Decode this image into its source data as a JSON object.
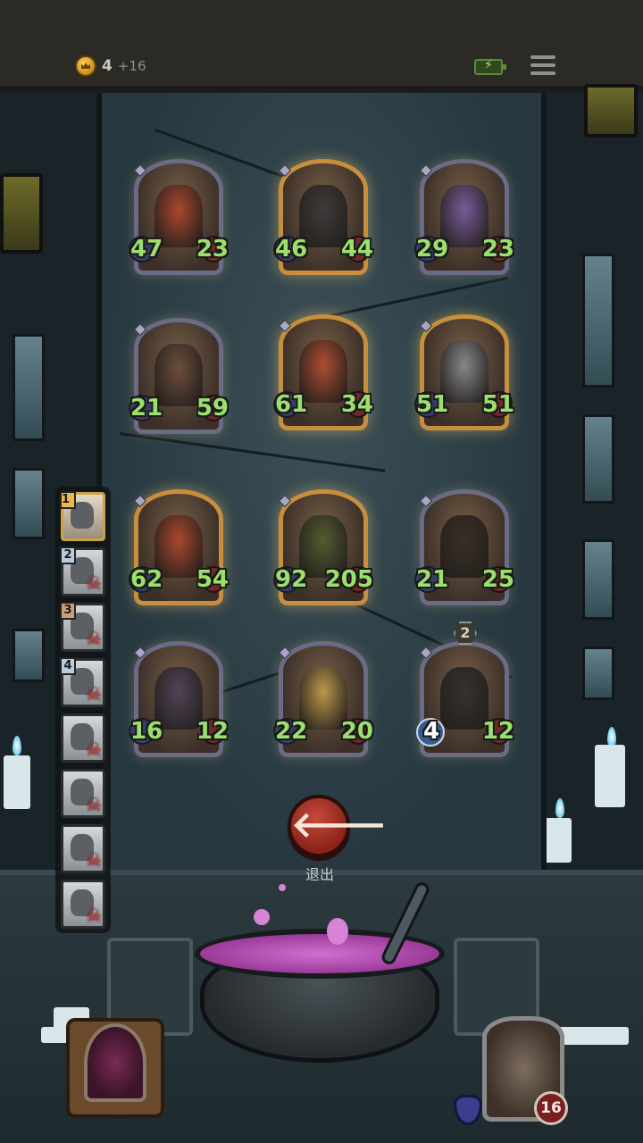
{
  "topbar": {
    "gold_count": "4",
    "gold_bonus": "+16"
  },
  "cards": [
    {
      "atk": "47",
      "hp": "23",
      "style": "silver",
      "color": "#b3432a"
    },
    {
      "atk": "46",
      "hp": "44",
      "style": "gold",
      "color": "#333538"
    },
    {
      "atk": "29",
      "hp": "23",
      "style": "silver",
      "color": "#7a5aa8"
    },
    {
      "atk": "21",
      "hp": "59",
      "style": "silver",
      "color": "#6a4a38"
    },
    {
      "atk": "61",
      "hp": "34",
      "style": "gold",
      "color": "#b74a2e"
    },
    {
      "atk": "51",
      "hp": "51",
      "style": "gold",
      "color": "#8a8f96"
    },
    {
      "atk": "62",
      "hp": "54",
      "style": "gold",
      "color": "#b3432a"
    },
    {
      "atk": "92",
      "hp": "205",
      "style": "gold",
      "color": "#4d5b2a"
    },
    {
      "atk": "21",
      "hp": "25",
      "style": "silver",
      "color": "#2f2620"
    },
    {
      "atk": "16",
      "hp": "12",
      "style": "silver",
      "color": "#4a3f5a"
    },
    {
      "atk": "22",
      "hp": "20",
      "style": "silver",
      "color": "#c8a24a"
    },
    {
      "atk": "4",
      "hp": "12",
      "style": "silver",
      "color": "#2a2a2a",
      "tier": "2"
    }
  ],
  "sidebar": {
    "slots": [
      {
        "num": "1",
        "rank": "gold",
        "defeated": false
      },
      {
        "num": "2",
        "rank": "blue",
        "defeated": true
      },
      {
        "num": "3",
        "rank": "bronze",
        "defeated": true
      },
      {
        "num": "4",
        "rank": "blue",
        "defeated": true
      },
      {
        "num": "",
        "rank": "none",
        "defeated": true
      },
      {
        "num": "",
        "rank": "none",
        "defeated": true
      },
      {
        "num": "",
        "rank": "none",
        "defeated": true
      },
      {
        "num": "",
        "rank": "none",
        "defeated": true
      }
    ]
  },
  "exit": {
    "icon": "arrow-left-icon",
    "label": "退出"
  },
  "player": {
    "health": "16"
  },
  "colors": {
    "atk_text": "#9be06c",
    "exit_red": "#a8342a"
  }
}
